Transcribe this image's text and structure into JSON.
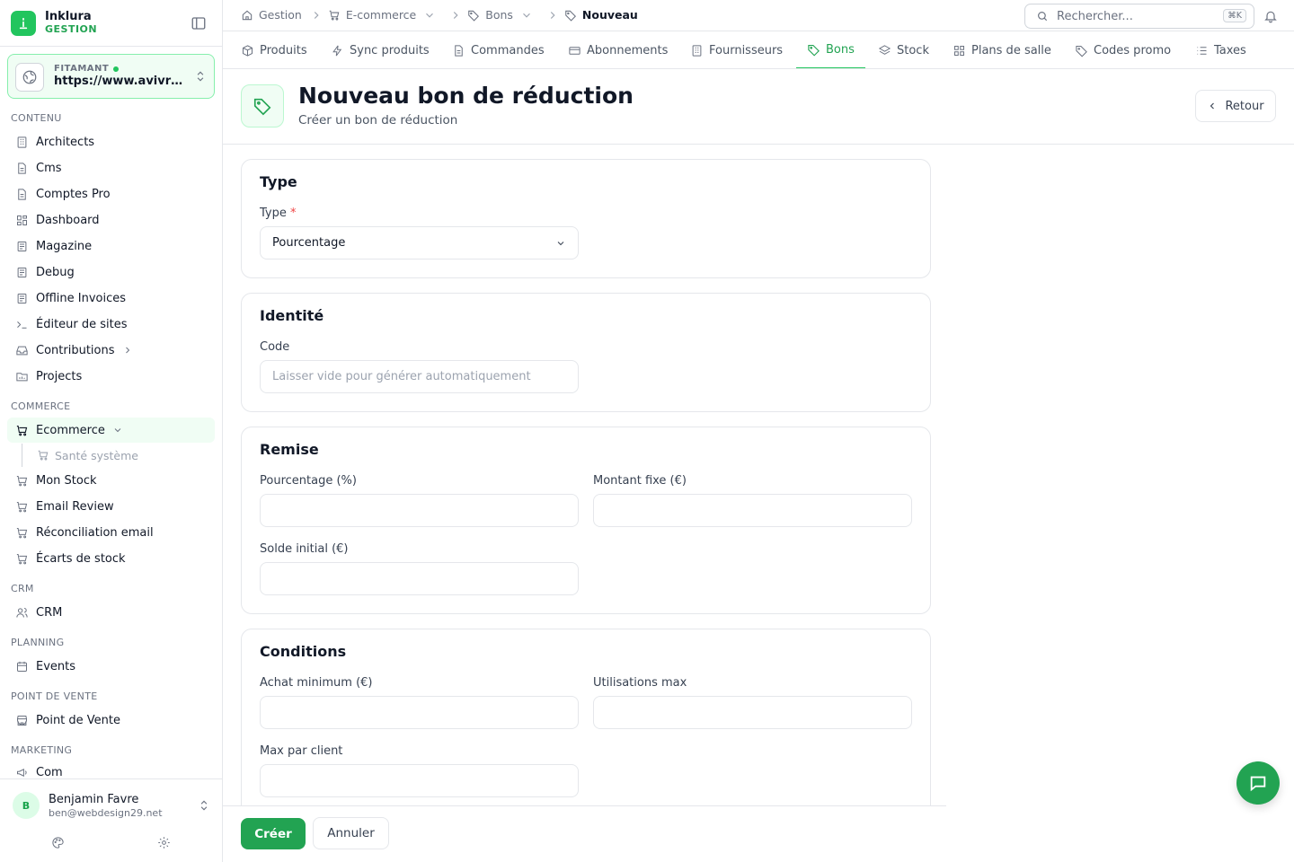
{
  "brand": {
    "name": "Inklura",
    "sub": "GESTION"
  },
  "site": {
    "label": "FITAMANT",
    "url": "https://www.avivre.fr"
  },
  "sidebar": {
    "sections": {
      "contenu": "CONTENU",
      "commerce": "COMMERCE",
      "crm": "CRM",
      "planning": "PLANNING",
      "pos": "POINT DE VENTE",
      "marketing": "MARKETING"
    },
    "items": {
      "architects": "Architects",
      "cms": "Cms",
      "comptes_pro": "Comptes Pro",
      "dashboard": "Dashboard",
      "magazine": "Magazine",
      "debug": "Debug",
      "offline_invoices": "Offline Invoices",
      "editeur": "Éditeur de sites",
      "contributions": "Contributions",
      "projects": "Projects",
      "ecommerce": "Ecommerce",
      "sante": "Santé système",
      "mon_stock": "Mon Stock",
      "email_review": "Email Review",
      "reconciliation": "Réconciliation email",
      "ecarts": "Écarts de stock",
      "crm": "CRM",
      "events": "Events",
      "pos": "Point de Vente",
      "com": "Com"
    }
  },
  "user": {
    "initial": "B",
    "name": "Benjamin Favre",
    "email": "ben@webdesign29.net"
  },
  "breadcrumb": {
    "gestion": "Gestion",
    "ecommerce": "E-commerce",
    "bons": "Bons",
    "current": "Nouveau"
  },
  "search": {
    "placeholder": "Rechercher...",
    "shortcut": "⌘K"
  },
  "tabs": {
    "produits": "Produits",
    "sync": "Sync produits",
    "commandes": "Commandes",
    "abonnements": "Abonnements",
    "fournisseurs": "Fournisseurs",
    "bons": "Bons",
    "stock": "Stock",
    "plans": "Plans de salle",
    "codes": "Codes promo",
    "taxes": "Taxes"
  },
  "header": {
    "title": "Nouveau bon de réduction",
    "subtitle": "Créer un bon de réduction",
    "back": "Retour"
  },
  "form": {
    "type": {
      "title": "Type",
      "label": "Type",
      "required": "*",
      "value": "Pourcentage"
    },
    "identite": {
      "title": "Identité",
      "code_label": "Code",
      "code_placeholder": "Laisser vide pour générer automatiquement"
    },
    "remise": {
      "title": "Remise",
      "pct_label": "Pourcentage (%)",
      "fixe_label": "Montant fixe (€)",
      "solde_label": "Solde initial (€)"
    },
    "conditions": {
      "title": "Conditions",
      "achat_label": "Achat minimum (€)",
      "util_label": "Utilisations max",
      "max_label": "Max par client"
    }
  },
  "actions": {
    "create": "Créer",
    "cancel": "Annuler"
  },
  "colors": {
    "accent": "#22a352",
    "accent_light": "#f0fdf4",
    "border": "#e5e7eb"
  }
}
